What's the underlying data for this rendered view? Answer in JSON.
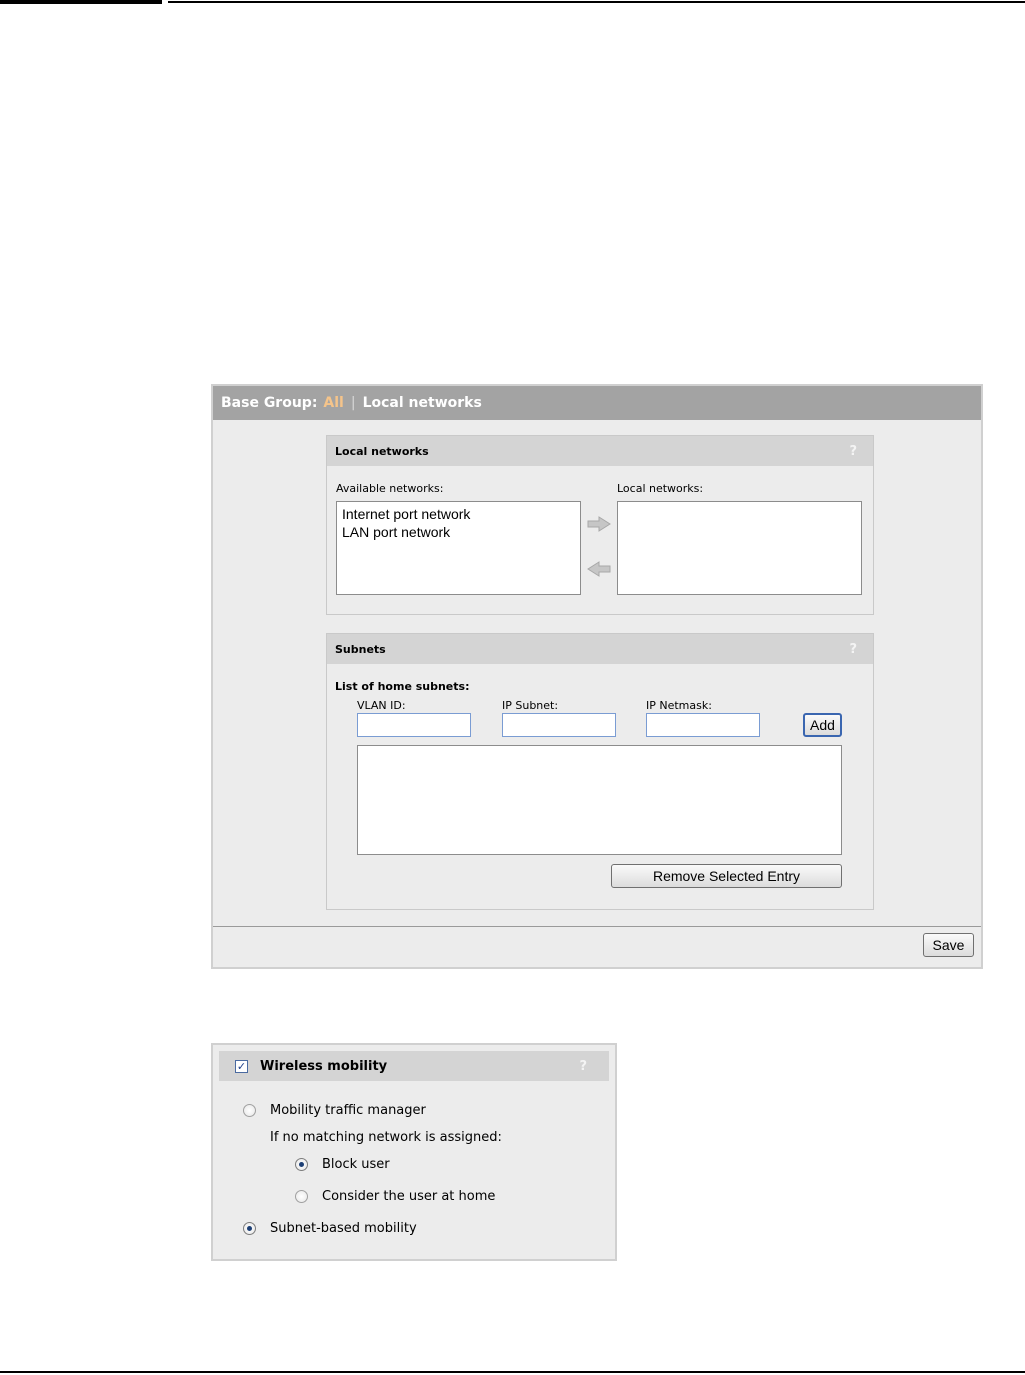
{
  "local_networks_page": {
    "breadcrumb": {
      "prefix": "Base Group:",
      "group": "All",
      "separator": "|",
      "page": "Local networks"
    },
    "local_networks_section": {
      "title": "Local networks",
      "help": "?",
      "available_label": "Available networks:",
      "available_items": [
        "Internet port network",
        "LAN port network"
      ],
      "local_label": "Local networks:",
      "local_items": []
    },
    "subnets_section": {
      "title": "Subnets",
      "help": "?",
      "list_label": "List of home subnets:",
      "vlan_label": "VLAN ID:",
      "vlan_value": "",
      "subnet_label": "IP Subnet:",
      "subnet_value": "",
      "netmask_label": "IP Netmask:",
      "netmask_value": "",
      "add_label": "Add",
      "remove_label": "Remove Selected Entry",
      "entries": []
    },
    "save_label": "Save"
  },
  "wireless_mobility": {
    "title": "Wireless mobility",
    "checked": true,
    "help": "?",
    "options": {
      "traffic_manager": "Mobility traffic manager",
      "no_match_label": "If no matching network is assigned:",
      "block_user": "Block user",
      "consider_home": "Consider the user at home",
      "subnet_based": "Subnet-based mobility"
    },
    "selected_mode": "Subnet-based mobility",
    "selected_no_match": "Block user"
  }
}
